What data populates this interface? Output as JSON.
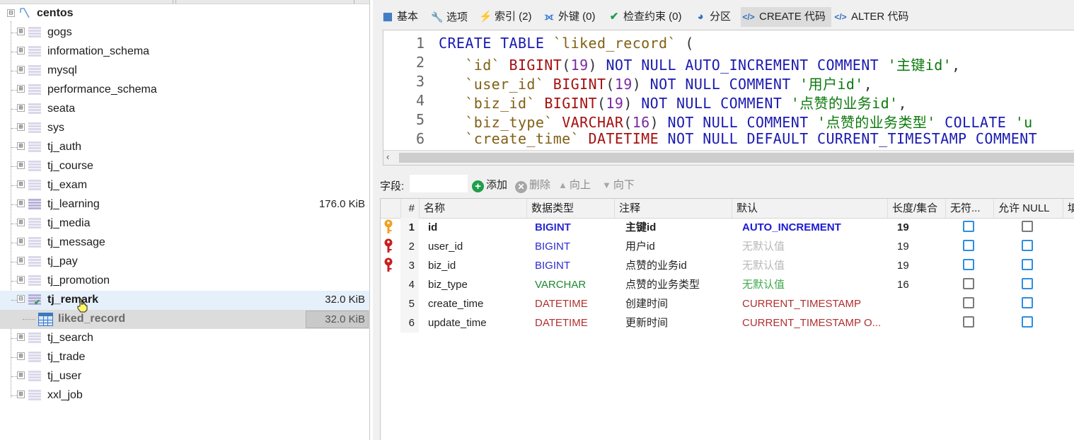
{
  "tree": {
    "root": {
      "label": "centos",
      "expander": "⊟"
    },
    "databases": [
      {
        "label": "gogs",
        "size": ""
      },
      {
        "label": "information_schema",
        "size": ""
      },
      {
        "label": "mysql",
        "size": ""
      },
      {
        "label": "performance_schema",
        "size": ""
      },
      {
        "label": "seata",
        "size": ""
      },
      {
        "label": "sys",
        "size": ""
      },
      {
        "label": "tj_auth",
        "size": ""
      },
      {
        "label": "tj_course",
        "size": ""
      },
      {
        "label": "tj_exam",
        "size": ""
      },
      {
        "label": "tj_learning",
        "size": "176.0 KiB"
      },
      {
        "label": "tj_media",
        "size": ""
      },
      {
        "label": "tj_message",
        "size": ""
      },
      {
        "label": "tj_pay",
        "size": ""
      },
      {
        "label": "tj_promotion",
        "size": ""
      },
      {
        "label": "tj_remark",
        "size": "32.0 KiB"
      },
      {
        "label": "tj_search",
        "size": ""
      },
      {
        "label": "tj_trade",
        "size": ""
      },
      {
        "label": "tj_user",
        "size": ""
      },
      {
        "label": "xxl_job",
        "size": ""
      }
    ],
    "child_table": {
      "label": "liked_record",
      "size": "32.0 KiB"
    },
    "collapsed_symbol": "⊞",
    "expanded_symbol": "⊟"
  },
  "tabs": [
    {
      "icon": "grid-icon",
      "glyph": "▦",
      "label": "基本"
    },
    {
      "icon": "wrench-icon",
      "glyph": "🔧",
      "label": "选项"
    },
    {
      "icon": "lightning-icon",
      "glyph": "⚡",
      "label": "索引 (2)"
    },
    {
      "icon": "foreign-key-icon",
      "glyph": "⟗",
      "label": "外键 (0)"
    },
    {
      "icon": "check-icon",
      "glyph": "✔",
      "label": "检查约束 (0)"
    },
    {
      "icon": "pie-icon",
      "glyph": "◕",
      "label": "分区"
    },
    {
      "icon": "code-icon",
      "glyph": "</>",
      "label": "CREATE 代码"
    },
    {
      "icon": "code-icon",
      "glyph": "</>",
      "label": "ALTER 代码"
    }
  ],
  "code": {
    "lines": [
      {
        "n": "1",
        "parts": [
          [
            "kw",
            "CREATE TABLE "
          ],
          [
            "bt",
            "`liked_record`"
          ],
          [
            "pn",
            " ("
          ]
        ]
      },
      {
        "n": "2",
        "parts": [
          [
            "bt",
            "   `id`"
          ],
          [
            "pn",
            " "
          ],
          [
            "ty",
            "BIGINT"
          ],
          [
            "pn",
            "("
          ],
          [
            "nm",
            "19"
          ],
          [
            "pn",
            ") "
          ],
          [
            "kw",
            "NOT NULL AUTO_INCREMENT COMMENT "
          ],
          [
            "st",
            "'主键id'"
          ],
          [
            "pn",
            ","
          ]
        ]
      },
      {
        "n": "3",
        "parts": [
          [
            "bt",
            "   `user_id`"
          ],
          [
            "pn",
            " "
          ],
          [
            "ty",
            "BIGINT"
          ],
          [
            "pn",
            "("
          ],
          [
            "nm",
            "19"
          ],
          [
            "pn",
            ") "
          ],
          [
            "kw",
            "NOT NULL COMMENT "
          ],
          [
            "st",
            "'用户id'"
          ],
          [
            "pn",
            ","
          ]
        ]
      },
      {
        "n": "4",
        "parts": [
          [
            "bt",
            "   `biz_id`"
          ],
          [
            "pn",
            " "
          ],
          [
            "ty",
            "BIGINT"
          ],
          [
            "pn",
            "("
          ],
          [
            "nm",
            "19"
          ],
          [
            "pn",
            ") "
          ],
          [
            "kw",
            "NOT NULL COMMENT "
          ],
          [
            "st",
            "'点赞的业务id'"
          ],
          [
            "pn",
            ","
          ]
        ]
      },
      {
        "n": "5",
        "parts": [
          [
            "bt",
            "   `biz_type`"
          ],
          [
            "pn",
            " "
          ],
          [
            "ty",
            "VARCHAR"
          ],
          [
            "pn",
            "("
          ],
          [
            "nm",
            "16"
          ],
          [
            "pn",
            ") "
          ],
          [
            "kw",
            "NOT NULL COMMENT "
          ],
          [
            "st",
            "'点赞的业务类型'"
          ],
          [
            "kw",
            " COLLATE "
          ],
          [
            "st",
            "'u"
          ]
        ]
      },
      {
        "n": "6",
        "parts": [
          [
            "bt",
            "   `create_time`"
          ],
          [
            "pn",
            " "
          ],
          [
            "ty",
            "DATETIME"
          ],
          [
            "pn",
            " "
          ],
          [
            "kw",
            "NOT NULL DEFAULT CURRENT_TIMESTAMP COMMENT"
          ]
        ]
      }
    ],
    "scroll_left_arrow": "‹"
  },
  "fields_bar": {
    "label": "字段:",
    "add": "添加",
    "delete": "删除",
    "up": "向上",
    "down": "向下"
  },
  "grid": {
    "headers": [
      "#",
      "名称",
      "数据类型",
      "注释",
      "默认",
      "长度/集合",
      "无符...",
      "允许 NULL",
      "填"
    ],
    "rows": [
      {
        "num": "1",
        "name": "id",
        "type": "BIGINT",
        "comment": "主键id",
        "default": "AUTO_INCREMENT",
        "length": "19",
        "key": "primary",
        "unsigned": "blue",
        "nullable": "gray",
        "bold": true,
        "type_class": "type-big",
        "default_class": "def-auto"
      },
      {
        "num": "2",
        "name": "user_id",
        "type": "BIGINT",
        "comment": "用户id",
        "default": "无默认值",
        "length": "19",
        "key": "index",
        "unsigned": "blue",
        "nullable": "blue",
        "bold": false,
        "type_class": "type-big",
        "default_class": "def-none"
      },
      {
        "num": "3",
        "name": "biz_id",
        "type": "BIGINT",
        "comment": "点赞的业务id",
        "default": "无默认值",
        "length": "19",
        "key": "index",
        "unsigned": "blue",
        "nullable": "blue",
        "bold": false,
        "type_class": "type-big",
        "default_class": "def-none"
      },
      {
        "num": "4",
        "name": "biz_type",
        "type": "VARCHAR",
        "comment": "点赞的业务类型",
        "default": "无默认值",
        "length": "16",
        "key": "",
        "unsigned": "gray",
        "nullable": "blue",
        "bold": false,
        "type_class": "type-var",
        "default_class": "def-none-green"
      },
      {
        "num": "5",
        "name": "create_time",
        "type": "DATETIME",
        "comment": "创建时间",
        "default": "CURRENT_TIMESTAMP",
        "length": "",
        "key": "",
        "unsigned": "gray",
        "nullable": "blue",
        "bold": false,
        "type_class": "type-dt",
        "default_class": "def-ts"
      },
      {
        "num": "6",
        "name": "update_time",
        "type": "DATETIME",
        "comment": "更新时间",
        "default": "CURRENT_TIMESTAMP O...",
        "length": "",
        "key": "",
        "unsigned": "gray",
        "nullable": "blue",
        "bold": false,
        "type_class": "type-dt",
        "default_class": "def-ts"
      }
    ]
  },
  "colors": {
    "keyword": "#1a1ab0",
    "string": "#0c7a0c",
    "type": "#a51010",
    "primary_key": "#f0a020",
    "index_key": "#c81e1e",
    "checkbox_blue": "#2e8de0"
  }
}
